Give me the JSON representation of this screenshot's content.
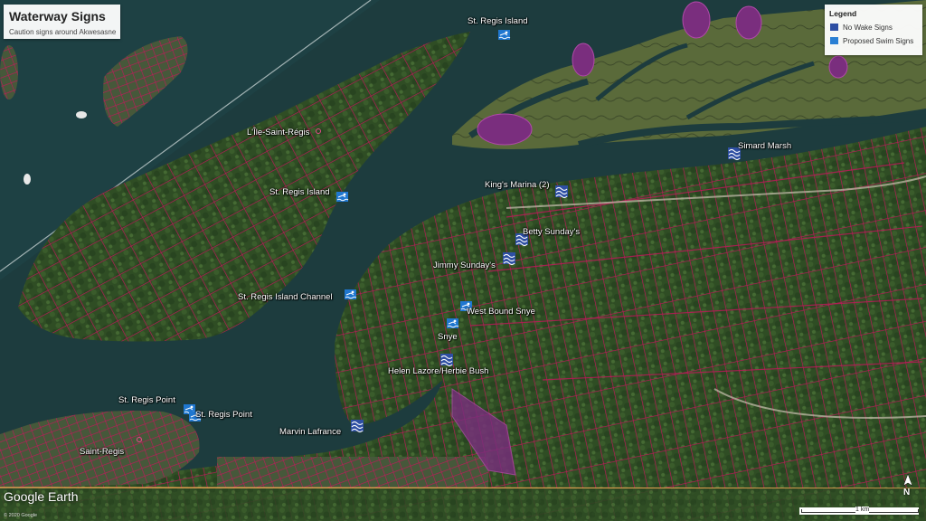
{
  "title": "Waterway Signs",
  "subtitle": "Caution signs around Akwesasne",
  "legend": {
    "title": "Legend",
    "items": [
      {
        "label": "No Wake Signs",
        "icon": "wave-icon",
        "color": "#2e4fa3"
      },
      {
        "label": "Proposed Swim Signs",
        "icon": "swimmer-icon",
        "color": "#2a7fd4"
      }
    ]
  },
  "places": [
    {
      "name": "St. Regis Island",
      "type": "swim"
    },
    {
      "name": "L'Île-Saint-Régis",
      "type": "place"
    },
    {
      "name": "St. Regis Island",
      "type": "swim"
    },
    {
      "name": "King's Marina (2)",
      "type": "nowake"
    },
    {
      "name": "Simard Marsh",
      "type": "nowake"
    },
    {
      "name": "Betty Sunday's",
      "type": "nowake"
    },
    {
      "name": "Jimmy Sunday's",
      "type": "nowake"
    },
    {
      "name": "St. Regis Island Channel",
      "type": "swim"
    },
    {
      "name": "West Bound Snye",
      "type": "swim"
    },
    {
      "name": "Snye",
      "type": "swim"
    },
    {
      "name": "Helen Lazore/Herbie Bush",
      "type": "nowake"
    },
    {
      "name": "St. Regis Point",
      "type": "swim"
    },
    {
      "name": "St. Regis Point",
      "type": "swim"
    },
    {
      "name": "Marvin Lafrance",
      "type": "nowake"
    },
    {
      "name": "Saint-Regis",
      "type": "place"
    }
  ],
  "brand": "Google Earth",
  "copyright": "© 2020 Google",
  "compass_label": "N",
  "scale_label": "1 km",
  "colors": {
    "water": "#1d3c3e",
    "land": "#3b5a2e",
    "parcels": "#c0185a",
    "marsh": "#7a2e7e"
  }
}
